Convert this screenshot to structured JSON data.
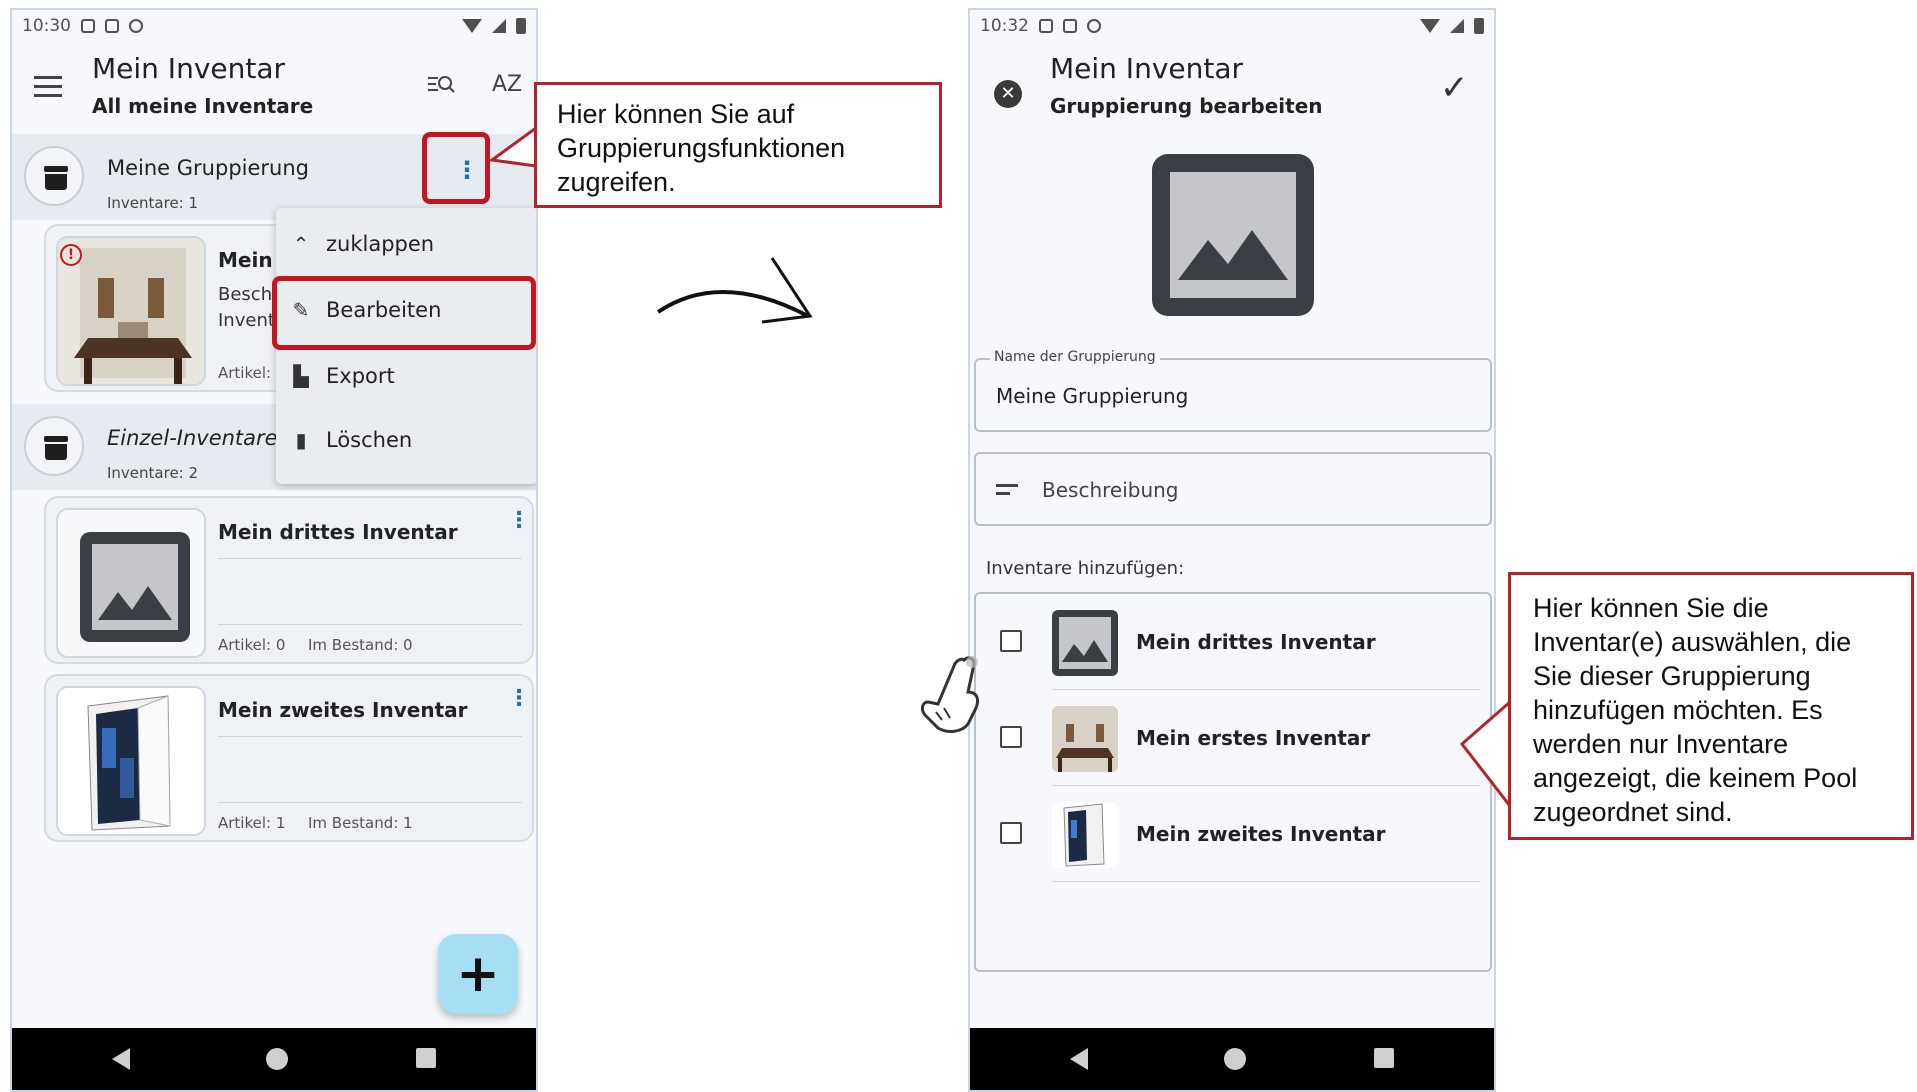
{
  "left_screen": {
    "status": {
      "time": "10:30"
    },
    "appbar": {
      "title": "Mein Inventar",
      "subtitle": "All meine Inventare",
      "sort_label": "AZ"
    },
    "group1": {
      "title": "Meine Gruppierung",
      "count": "Inventare: 1"
    },
    "group2": {
      "title": "Einzel-Inventare",
      "count": "Inventare: 2"
    },
    "card1": {
      "title_partial": "Mein e",
      "desc_partial": "Besch",
      "inv_partial": "Invent",
      "meta_partial": "Artikel:"
    },
    "card2": {
      "title": "Mein drittes Inventar",
      "articles": "Artikel: 0",
      "stock": "Im Bestand: 0"
    },
    "card3": {
      "title": "Mein zweites Inventar",
      "articles": "Artikel: 1",
      "stock": "Im Bestand: 1"
    },
    "menu": {
      "items": [
        "zuklappen",
        "Bearbeiten",
        "Export",
        "Löschen"
      ]
    },
    "fab_label": "+"
  },
  "right_screen": {
    "status": {
      "time": "10:32"
    },
    "appbar": {
      "title": "Mein Inventar",
      "subtitle": "Gruppierung bearbeiten"
    },
    "name_field": {
      "label": "Name der Gruppierung",
      "value": "Meine Gruppierung"
    },
    "description_field": {
      "placeholder": "Beschreibung"
    },
    "add_section_label": "Inventare hinzufügen:",
    "list": [
      "Mein drittes Inventar",
      "Mein erstes Inventar",
      "Mein zweites Inventar"
    ]
  },
  "annotations": {
    "callout1": "Hier können Sie auf Gruppierungsfunktionen zugreifen.",
    "callout2": "Hier können Sie die Inventar(e) auswählen, die Sie dieser Gruppierung hinzufügen möchten. Es werden nur Inventare angezeigt, die keinem Pool zugeordnet sind."
  },
  "colors": {
    "highlight_red": "#c4161c",
    "fab": "#a8def4",
    "kebab_blue": "#1c6fb6"
  }
}
